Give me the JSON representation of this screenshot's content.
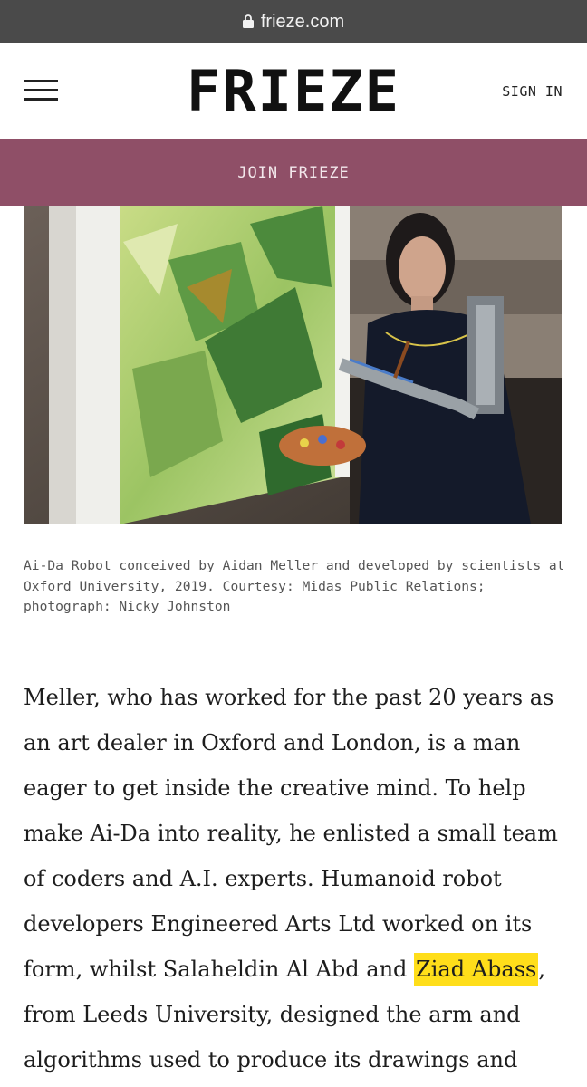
{
  "browser": {
    "url": "frieze.com",
    "lock_icon": "lock-icon"
  },
  "header": {
    "menu_icon": "hamburger-menu-icon",
    "logo": "FRIEZE",
    "sign_in_label": "SIGN IN"
  },
  "banner": {
    "join_label": "JOIN FRIEZE",
    "color": "#8f4f67"
  },
  "figure": {
    "caption": "Ai-Da Robot conceived by Aidan Meller and developed by scientists at Oxford University, 2019. Courtesy: Midas Public Relations; photograph: Nicky Johnston"
  },
  "article": {
    "before_highlight": "Meller, who has worked for the past 20 years as an art dealer in Oxford and London, is a man eager to get inside the creative mind. To help make Ai-Da into reality, he enlisted a small team of coders and A.I. experts. Humanoid robot developers Engineered Arts Ltd worked on its form, whilst Salaheldin Al Abd and ",
    "highlight": "Ziad Abass",
    "after_highlight": ", from Leeds University, designed the arm and algorithms used to produce its drawings and paintings. A selection",
    "highlight_color": "#ffde1a"
  }
}
